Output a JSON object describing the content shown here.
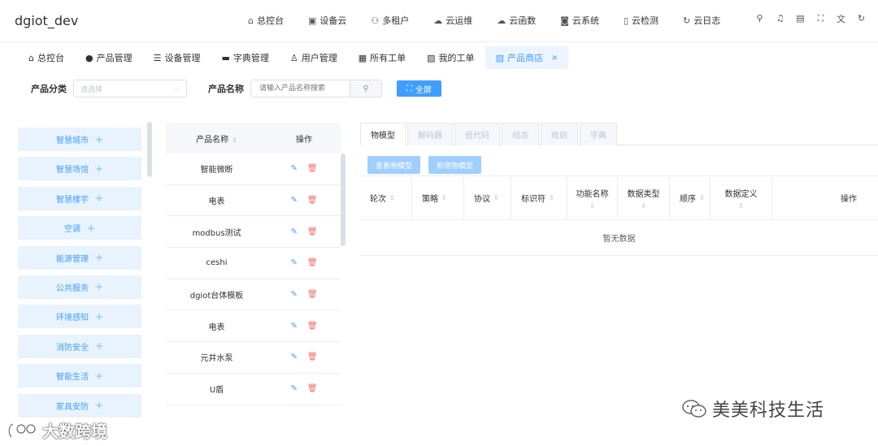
{
  "header": {
    "title": "dgiot_dev",
    "nav": [
      {
        "label": "总控台",
        "icon": "home-icon"
      },
      {
        "label": "设备云",
        "icon": "device-cloud-icon"
      },
      {
        "label": "多租户",
        "icon": "users-icon"
      },
      {
        "label": "云运维",
        "icon": "cloud-ops-icon"
      },
      {
        "label": "云函数",
        "icon": "cloud-function-icon"
      },
      {
        "label": "云系统",
        "icon": "cloud-system-icon"
      },
      {
        "label": "云检测",
        "icon": "cloud-check-icon"
      },
      {
        "label": "云日志",
        "icon": "cloud-log-icon"
      }
    ],
    "tools": [
      "tree-icon",
      "bell-icon",
      "doc-icon",
      "fullscreen-icon",
      "translate-icon",
      "refresh-icon"
    ]
  },
  "tabs": [
    {
      "label": "总控台"
    },
    {
      "label": "产品管理"
    },
    {
      "label": "设备管理"
    },
    {
      "label": "字典管理"
    },
    {
      "label": "用户管理"
    },
    {
      "label": "所有工单"
    },
    {
      "label": "我的工单"
    },
    {
      "label": "产品商店",
      "active": true
    }
  ],
  "filter": {
    "category_label": "产品分类",
    "category_placeholder": "请选择",
    "name_label": "产品名称",
    "name_placeholder": "请输入产品名称搜索",
    "fullscreen_label": "全屏"
  },
  "categories": [
    "智慧城市",
    "智慧场馆",
    "智慧楼宇",
    "空调",
    "能源管理",
    "公共服务",
    "环境感知",
    "消防安全",
    "智能生活",
    "家具安防"
  ],
  "product_table": {
    "col_name": "产品名称",
    "col_action": "操作",
    "rows": [
      "智能微断",
      "电表",
      "modbus测试",
      "ceshi",
      "dgiot台体模板",
      "电表",
      "元井水泵",
      "U盾"
    ]
  },
  "detail": {
    "tabs": [
      "物模型",
      "解码器",
      "低代码",
      "组态",
      "规则",
      "字典"
    ],
    "buttons": {
      "view": "查看物模型",
      "add": "新增物模型"
    },
    "columns": [
      "轮次",
      "策略",
      "协议",
      "标识符",
      "功能名称",
      "数据类型",
      "顺序",
      "数据定义",
      "操作"
    ],
    "empty": "暂无数据"
  },
  "watermarks": {
    "wechat": "美美科技生活",
    "brand": "大数跨境"
  },
  "colors": {
    "primary": "#409eff",
    "danger": "#f56c6c",
    "category_bg": "#e8f3fd"
  }
}
